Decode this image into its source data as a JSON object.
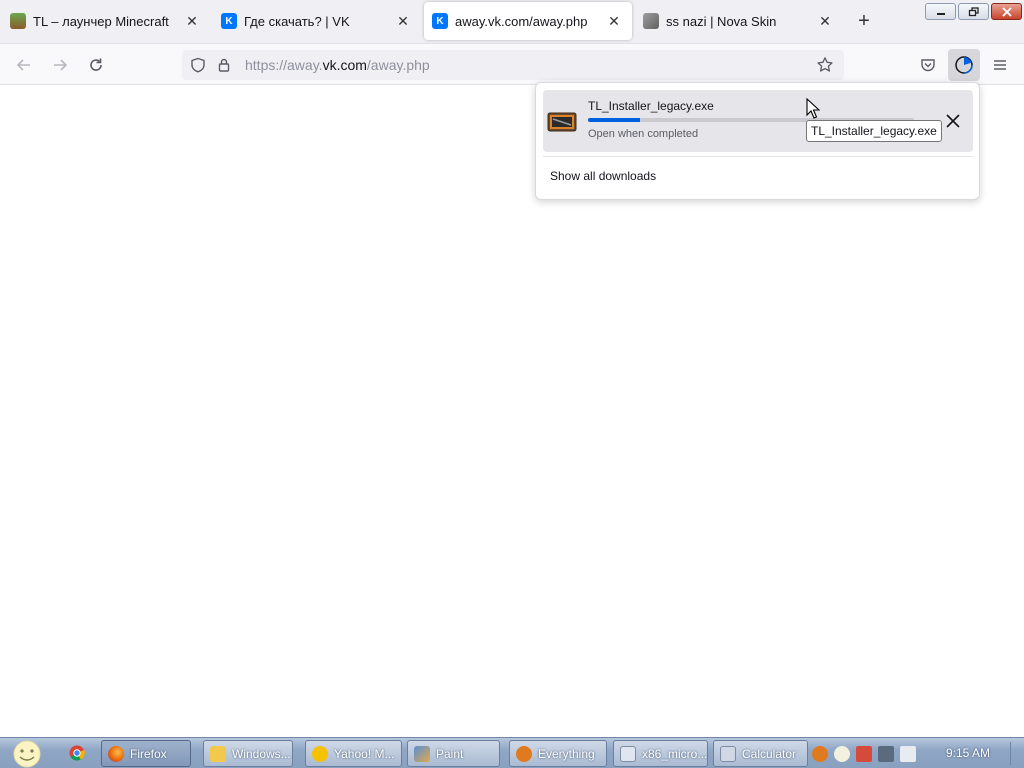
{
  "tabs": [
    {
      "title": "TL – лаунчер Minecraft",
      "favicon": "tl-launcher-icon",
      "active": false
    },
    {
      "title": "Где скачать? | VK",
      "favicon": "vk-icon",
      "active": false
    },
    {
      "title": "away.vk.com/away.php",
      "favicon": "vk-icon",
      "active": true
    },
    {
      "title": "ss nazi | Nova Skin",
      "favicon": "nova-skin-icon",
      "active": false
    }
  ],
  "new_tab_symbol": "+",
  "close_symbol": "✕",
  "url": {
    "prefix": "https://away.",
    "domain": "vk.com",
    "suffix": "/away.php"
  },
  "downloads": {
    "item": {
      "filename": "TL_Installer_legacy.exe",
      "status": "Open when completed",
      "progress": 0.16
    },
    "show_all": "Show all downloads",
    "tooltip": "TL_Installer_legacy.exe"
  },
  "taskbar": {
    "items": [
      {
        "label": "Firefox",
        "icon": "firefox-icon",
        "color": "#e66000",
        "active": true
      },
      {
        "label": "Windows...",
        "icon": "windows-folder-icon",
        "color": "#f2c94c",
        "active": false
      },
      {
        "label": "Yahoo! M...",
        "icon": "yahoo-messenger-icon",
        "color": "#f6c200",
        "active": false
      },
      {
        "label": "Paint",
        "icon": "paint-icon",
        "color": "#5b8fd6",
        "active": false
      },
      {
        "label": "Everything",
        "icon": "everything-search-icon",
        "color": "#e07a1f",
        "active": false
      },
      {
        "label": "x86_micro...",
        "icon": "text-file-icon",
        "color": "#dfe6ef",
        "active": false
      },
      {
        "label": "Calculator",
        "icon": "calculator-icon",
        "color": "#cfd8e4",
        "active": false
      }
    ],
    "clock": "9:15 AM"
  },
  "colors": {
    "accent": "#0061e0",
    "vk": "#0077ff"
  }
}
